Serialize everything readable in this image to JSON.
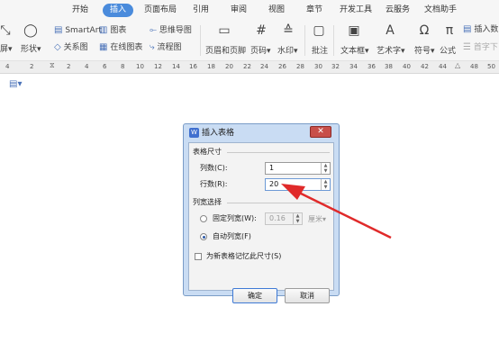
{
  "menu_tabs": [
    "开始",
    "插入",
    "页面布局",
    "引用",
    "审阅",
    "视图",
    "章节",
    "开发工具",
    "云服务",
    "文档助手"
  ],
  "active_tab": "插入",
  "ribbon": {
    "smartart": "SmartArt",
    "chart": "图表",
    "mindmap": "思维导图",
    "relation": "关系图",
    "online_chart": "在线图表",
    "flowchart": "流程图",
    "screen_frag": "屏",
    "shape": "形状",
    "header_footer": "页眉和页脚",
    "page_num": "页码",
    "watermark": "水印",
    "comment": "批注",
    "textbox": "文本框",
    "wordart": "艺术字",
    "symbol": "符号",
    "formula": "公式",
    "right_top": "插入数",
    "right_bottom": "首字下"
  },
  "ruler_ticks": [
    "4",
    "2",
    "2",
    "4",
    "6",
    "8",
    "10",
    "12",
    "14",
    "16",
    "18",
    "20",
    "22",
    "24",
    "26",
    "28",
    "30",
    "32",
    "34",
    "36",
    "38",
    "40",
    "42",
    "44",
    "48",
    "50"
  ],
  "dialog": {
    "title": "插入表格",
    "logo": "W",
    "close": "✕",
    "table_size_label": "表格尺寸",
    "cols_label": "列数(C):",
    "cols_value": "1",
    "rows_label": "行数(R):",
    "rows_value": "20",
    "width_label": "列宽选择",
    "fixed_width_label": "固定列宽(W):",
    "fixed_width_value": "0.16",
    "unit": "厘米",
    "auto_width_label": "自动列宽(F)",
    "remember_label": "为新表格记忆此尺寸(S)",
    "ok": "确定",
    "cancel": "取消"
  },
  "colors": {
    "active_tab": "#4a8bdc",
    "arrow": "#e02a2a",
    "dialog_frame": "#c9dcf3"
  }
}
